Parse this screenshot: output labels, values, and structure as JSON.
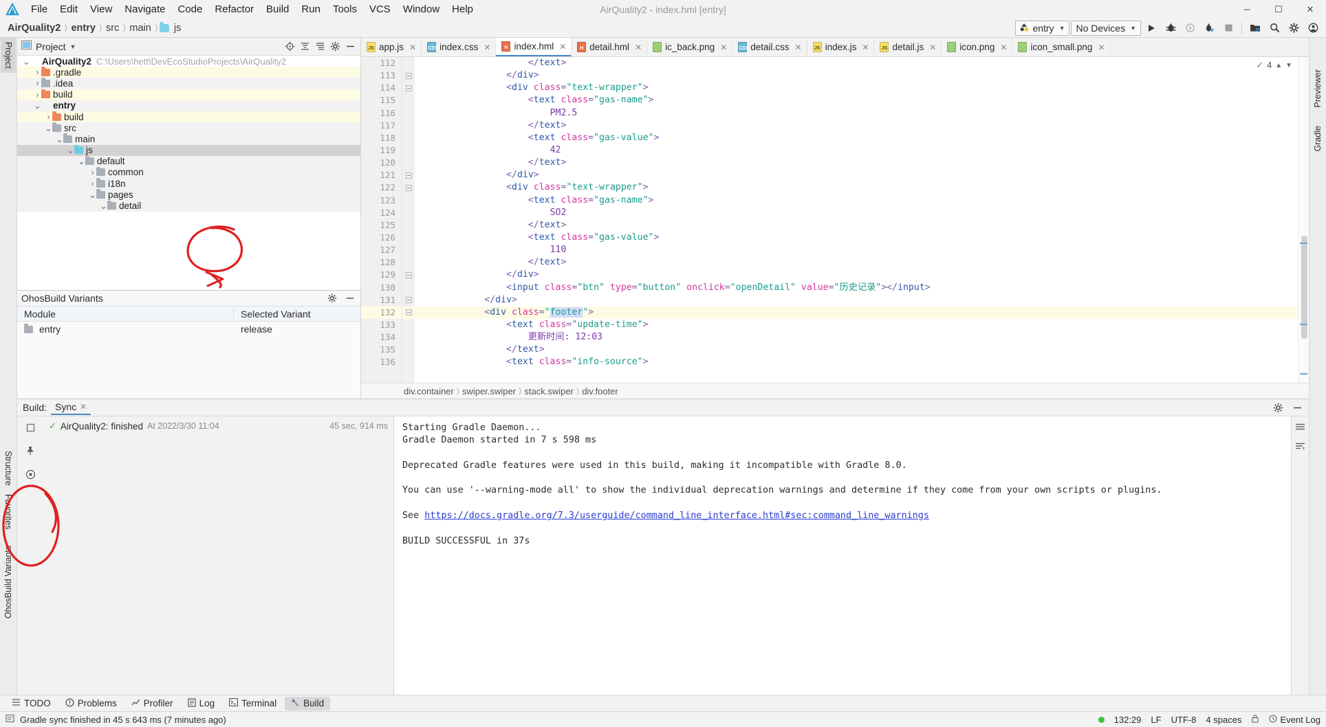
{
  "window": {
    "title": "AirQuality2 - index.hml [entry]",
    "minimize": "─",
    "maximize": "☐",
    "close": "✕"
  },
  "menu": {
    "items": [
      "File",
      "Edit",
      "View",
      "Navigate",
      "Code",
      "Refactor",
      "Build",
      "Run",
      "Tools",
      "VCS",
      "Window",
      "Help"
    ]
  },
  "navbar": {
    "breadcrumbs": [
      {
        "label": "AirQuality2",
        "bold": true,
        "folder": false
      },
      {
        "label": "entry",
        "bold": true,
        "folder": false
      },
      {
        "label": "src",
        "bold": false,
        "folder": false
      },
      {
        "label": "main",
        "bold": false,
        "folder": false
      },
      {
        "label": "js",
        "bold": false,
        "folder": true
      }
    ],
    "run_config": "entry",
    "device": "No Devices",
    "icons": [
      "run-icon",
      "debug-icon",
      "attach-debugger-icon",
      "profile-icon",
      "stop-icon",
      "device-manager-icon",
      "search-everywhere-icon",
      "settings-icon",
      "account-icon"
    ]
  },
  "left_strip": {
    "tabs": [
      "Project",
      "Structure",
      "Favorites",
      "OhosBuild Variants"
    ]
  },
  "right_strip": {
    "tabs": [
      "Previewer",
      "Gradle"
    ]
  },
  "project_panel": {
    "title": "Project",
    "tree": [
      {
        "indent": 0,
        "arrow": "down",
        "icon": "module",
        "label": "AirQuality2",
        "bold": true,
        "path": "C:\\Users\\hett\\DevEcoStudioProjects\\AirQuality2",
        "bg": "w"
      },
      {
        "indent": 1,
        "arrow": "right",
        "icon": "orange",
        "label": ".gradle",
        "bold": false,
        "path": "",
        "bg": "y"
      },
      {
        "indent": 1,
        "arrow": "right",
        "icon": "gray",
        "label": ".idea",
        "bold": false,
        "path": "",
        "bg": "g"
      },
      {
        "indent": 1,
        "arrow": "right",
        "icon": "orange",
        "label": "build",
        "bold": false,
        "path": "",
        "bg": "y"
      },
      {
        "indent": 1,
        "arrow": "down",
        "icon": "module",
        "label": "entry",
        "bold": true,
        "path": "",
        "bg": "g"
      },
      {
        "indent": 2,
        "arrow": "right",
        "icon": "orange",
        "label": "build",
        "bold": false,
        "path": "",
        "bg": "y"
      },
      {
        "indent": 2,
        "arrow": "down",
        "icon": "gray",
        "label": "src",
        "bold": false,
        "path": "",
        "bg": "g"
      },
      {
        "indent": 3,
        "arrow": "down",
        "icon": "gray",
        "label": "main",
        "bold": false,
        "path": "",
        "bg": "g"
      },
      {
        "indent": 4,
        "arrow": "down",
        "icon": "blue",
        "label": "js",
        "bold": false,
        "path": "",
        "bg": "sel"
      },
      {
        "indent": 5,
        "arrow": "down",
        "icon": "gray",
        "label": "default",
        "bold": false,
        "path": "",
        "bg": "g"
      },
      {
        "indent": 6,
        "arrow": "right",
        "icon": "gray",
        "label": "common",
        "bold": false,
        "path": "",
        "bg": "g"
      },
      {
        "indent": 6,
        "arrow": "right",
        "icon": "gray",
        "label": "i18n",
        "bold": false,
        "path": "",
        "bg": "g"
      },
      {
        "indent": 6,
        "arrow": "down",
        "icon": "gray",
        "label": "pages",
        "bold": false,
        "path": "",
        "bg": "g"
      },
      {
        "indent": 7,
        "arrow": "down",
        "icon": "gray",
        "label": "detail",
        "bold": false,
        "path": "",
        "bg": "g"
      }
    ]
  },
  "build_variants": {
    "title": "OhosBuild Variants",
    "columns": [
      "Module",
      "Selected Variant"
    ],
    "rows": [
      {
        "module": "entry",
        "variant": "release"
      }
    ]
  },
  "editor": {
    "tabs": [
      {
        "label": "app.js",
        "kind": "js",
        "badge": "JS",
        "active": false
      },
      {
        "label": "index.css",
        "kind": "css",
        "badge": "CSS",
        "active": false
      },
      {
        "label": "index.hml",
        "kind": "hml",
        "badge": "H",
        "active": true
      },
      {
        "label": "detail.hml",
        "kind": "hml",
        "badge": "H",
        "active": false
      },
      {
        "label": "ic_back.png",
        "kind": "png",
        "badge": "",
        "active": false
      },
      {
        "label": "detail.css",
        "kind": "css",
        "badge": "CSS",
        "active": false
      },
      {
        "label": "index.js",
        "kind": "js",
        "badge": "JS",
        "active": false
      },
      {
        "label": "detail.js",
        "kind": "js",
        "badge": "JS",
        "active": false
      },
      {
        "label": "icon.png",
        "kind": "png",
        "badge": "",
        "active": false
      },
      {
        "label": "icon_small.png",
        "kind": "png",
        "badge": "",
        "active": false
      }
    ],
    "inspection_count": "4",
    "first_line": 112,
    "current_line": 132,
    "lines": [
      {
        "n": 112,
        "indent": 10,
        "fold": false,
        "parts": [
          {
            "t": "ang",
            "s": "</"
          },
          {
            "t": "tag",
            "s": "text"
          },
          {
            "t": "ang",
            "s": ">"
          }
        ]
      },
      {
        "n": 113,
        "indent": 8,
        "fold": true,
        "parts": [
          {
            "t": "ang",
            "s": "</"
          },
          {
            "t": "tag",
            "s": "div"
          },
          {
            "t": "ang",
            "s": ">"
          }
        ]
      },
      {
        "n": 114,
        "indent": 8,
        "fold": true,
        "parts": [
          {
            "t": "ang",
            "s": "<"
          },
          {
            "t": "tag",
            "s": "div "
          },
          {
            "t": "attr",
            "s": "class"
          },
          {
            "t": "ang",
            "s": "="
          },
          {
            "t": "str",
            "s": "\"text-wrapper\""
          },
          {
            "t": "ang",
            "s": ">"
          }
        ]
      },
      {
        "n": 115,
        "indent": 10,
        "fold": false,
        "parts": [
          {
            "t": "ang",
            "s": "<"
          },
          {
            "t": "tag",
            "s": "text "
          },
          {
            "t": "attr",
            "s": "class"
          },
          {
            "t": "ang",
            "s": "="
          },
          {
            "t": "str",
            "s": "\"gas-name\""
          },
          {
            "t": "ang",
            "s": ">"
          }
        ]
      },
      {
        "n": 116,
        "indent": 12,
        "fold": false,
        "parts": [
          {
            "t": "txtc",
            "s": "PM2.5"
          }
        ]
      },
      {
        "n": 117,
        "indent": 10,
        "fold": false,
        "parts": [
          {
            "t": "ang",
            "s": "</"
          },
          {
            "t": "tag",
            "s": "text"
          },
          {
            "t": "ang",
            "s": ">"
          }
        ]
      },
      {
        "n": 118,
        "indent": 10,
        "fold": false,
        "parts": [
          {
            "t": "ang",
            "s": "<"
          },
          {
            "t": "tag",
            "s": "text "
          },
          {
            "t": "attr",
            "s": "class"
          },
          {
            "t": "ang",
            "s": "="
          },
          {
            "t": "str",
            "s": "\"gas-value\""
          },
          {
            "t": "ang",
            "s": ">"
          }
        ]
      },
      {
        "n": 119,
        "indent": 12,
        "fold": false,
        "parts": [
          {
            "t": "txtc",
            "s": "42"
          }
        ]
      },
      {
        "n": 120,
        "indent": 10,
        "fold": false,
        "parts": [
          {
            "t": "ang",
            "s": "</"
          },
          {
            "t": "tag",
            "s": "text"
          },
          {
            "t": "ang",
            "s": ">"
          }
        ]
      },
      {
        "n": 121,
        "indent": 8,
        "fold": true,
        "parts": [
          {
            "t": "ang",
            "s": "</"
          },
          {
            "t": "tag",
            "s": "div"
          },
          {
            "t": "ang",
            "s": ">"
          }
        ]
      },
      {
        "n": 122,
        "indent": 8,
        "fold": true,
        "parts": [
          {
            "t": "ang",
            "s": "<"
          },
          {
            "t": "tag",
            "s": "div "
          },
          {
            "t": "attr",
            "s": "class"
          },
          {
            "t": "ang",
            "s": "="
          },
          {
            "t": "str",
            "s": "\"text-wrapper\""
          },
          {
            "t": "ang",
            "s": ">"
          }
        ]
      },
      {
        "n": 123,
        "indent": 10,
        "fold": false,
        "parts": [
          {
            "t": "ang",
            "s": "<"
          },
          {
            "t": "tag",
            "s": "text "
          },
          {
            "t": "attr",
            "s": "class"
          },
          {
            "t": "ang",
            "s": "="
          },
          {
            "t": "str",
            "s": "\"gas-name\""
          },
          {
            "t": "ang",
            "s": ">"
          }
        ]
      },
      {
        "n": 124,
        "indent": 12,
        "fold": false,
        "parts": [
          {
            "t": "txtc",
            "s": "SO2"
          }
        ]
      },
      {
        "n": 125,
        "indent": 10,
        "fold": false,
        "parts": [
          {
            "t": "ang",
            "s": "</"
          },
          {
            "t": "tag",
            "s": "text"
          },
          {
            "t": "ang",
            "s": ">"
          }
        ]
      },
      {
        "n": 126,
        "indent": 10,
        "fold": false,
        "parts": [
          {
            "t": "ang",
            "s": "<"
          },
          {
            "t": "tag",
            "s": "text "
          },
          {
            "t": "attr",
            "s": "class"
          },
          {
            "t": "ang",
            "s": "="
          },
          {
            "t": "str",
            "s": "\"gas-value\""
          },
          {
            "t": "ang",
            "s": ">"
          }
        ]
      },
      {
        "n": 127,
        "indent": 12,
        "fold": false,
        "parts": [
          {
            "t": "txtc",
            "s": "110"
          }
        ]
      },
      {
        "n": 128,
        "indent": 10,
        "fold": false,
        "parts": [
          {
            "t": "ang",
            "s": "</"
          },
          {
            "t": "tag",
            "s": "text"
          },
          {
            "t": "ang",
            "s": ">"
          }
        ]
      },
      {
        "n": 129,
        "indent": 8,
        "fold": true,
        "parts": [
          {
            "t": "ang",
            "s": "</"
          },
          {
            "t": "tag",
            "s": "div"
          },
          {
            "t": "ang",
            "s": ">"
          }
        ]
      },
      {
        "n": 130,
        "indent": 8,
        "fold": false,
        "parts": [
          {
            "t": "ang",
            "s": "<"
          },
          {
            "t": "tag",
            "s": "input "
          },
          {
            "t": "attr",
            "s": "class"
          },
          {
            "t": "ang",
            "s": "="
          },
          {
            "t": "str",
            "s": "\"btn\""
          },
          {
            "t": "ang",
            "s": " "
          },
          {
            "t": "attr",
            "s": "type"
          },
          {
            "t": "ang",
            "s": "="
          },
          {
            "t": "str",
            "s": "\"button\""
          },
          {
            "t": "ang",
            "s": " "
          },
          {
            "t": "attr",
            "s": "onclick"
          },
          {
            "t": "ang",
            "s": "="
          },
          {
            "t": "str",
            "s": "\"openDetail\""
          },
          {
            "t": "ang",
            "s": " "
          },
          {
            "t": "attr",
            "s": "value"
          },
          {
            "t": "ang",
            "s": "="
          },
          {
            "t": "str",
            "s": "\"历史记录\""
          },
          {
            "t": "ang",
            "s": ">"
          },
          {
            "t": "ang",
            "s": "</"
          },
          {
            "t": "tag",
            "s": "input"
          },
          {
            "t": "ang",
            "s": ">"
          }
        ]
      },
      {
        "n": 131,
        "indent": 6,
        "fold": true,
        "parts": [
          {
            "t": "ang",
            "s": "</"
          },
          {
            "t": "tag",
            "s": "div"
          },
          {
            "t": "ang",
            "s": ">"
          }
        ]
      },
      {
        "n": 132,
        "indent": 6,
        "fold": true,
        "parts": [
          {
            "t": "ang",
            "s": "<"
          },
          {
            "t": "tag",
            "s": "div "
          },
          {
            "t": "attr",
            "s": "class"
          },
          {
            "t": "ang",
            "s": "="
          },
          {
            "t": "str",
            "s": "\""
          },
          {
            "t": "sel",
            "s": "footer"
          },
          {
            "t": "str",
            "s": "\""
          },
          {
            "t": "ang",
            "s": ">"
          }
        ]
      },
      {
        "n": 133,
        "indent": 8,
        "fold": false,
        "parts": [
          {
            "t": "ang",
            "s": "<"
          },
          {
            "t": "tag",
            "s": "text "
          },
          {
            "t": "attr",
            "s": "class"
          },
          {
            "t": "ang",
            "s": "="
          },
          {
            "t": "str",
            "s": "\"update-time\""
          },
          {
            "t": "ang",
            "s": ">"
          }
        ]
      },
      {
        "n": 134,
        "indent": 10,
        "fold": false,
        "parts": [
          {
            "t": "txtc",
            "s": "更新时间: 12:03"
          }
        ]
      },
      {
        "n": 135,
        "indent": 8,
        "fold": false,
        "parts": [
          {
            "t": "ang",
            "s": "</"
          },
          {
            "t": "tag",
            "s": "text"
          },
          {
            "t": "ang",
            "s": ">"
          }
        ]
      },
      {
        "n": 136,
        "indent": 8,
        "fold": false,
        "parts": [
          {
            "t": "ang",
            "s": "<"
          },
          {
            "t": "tag",
            "s": "text "
          },
          {
            "t": "attr",
            "s": "class"
          },
          {
            "t": "ang",
            "s": "="
          },
          {
            "t": "str",
            "s": "\"info-source\""
          },
          {
            "t": "ang",
            "s": ">"
          }
        ]
      }
    ],
    "structure_crumbs": [
      "div.container",
      "swiper.swiper",
      "stack.swiper",
      "div.footer"
    ]
  },
  "build_window": {
    "label": "Build:",
    "tab": "Sync",
    "tree_row": {
      "status": "AirQuality2: finished",
      "timestamp": "At 2022/3/30 11:04",
      "duration": "45 sec, 914 ms"
    },
    "log": [
      {
        "text": "Starting Gradle Daemon...",
        "link": null
      },
      {
        "text": "Gradle Daemon started in 7 s 598 ms",
        "link": null
      },
      {
        "text": "",
        "link": null
      },
      {
        "text": "Deprecated Gradle features were used in this build, making it incompatible with Gradle 8.0.",
        "link": null
      },
      {
        "text": "",
        "link": null
      },
      {
        "text": "You can use '--warning-mode all' to show the individual deprecation warnings and determine if they come from your own scripts or plugins.",
        "link": null
      },
      {
        "text": "",
        "link": null
      },
      {
        "text": "See ",
        "link": "https://docs.gradle.org/7.3/userguide/command_line_interface.html#sec:command_line_warnings"
      },
      {
        "text": "",
        "link": null
      },
      {
        "text": "BUILD SUCCESSFUL in 37s",
        "link": null
      }
    ]
  },
  "bottom_bar": {
    "items": [
      {
        "label": "TODO",
        "icon": "todo-icon",
        "active": false
      },
      {
        "label": "Problems",
        "icon": "problems-icon",
        "active": false
      },
      {
        "label": "Profiler",
        "icon": "profiler-icon",
        "active": false
      },
      {
        "label": "Log",
        "icon": "log-icon",
        "active": false
      },
      {
        "label": "Terminal",
        "icon": "terminal-icon",
        "active": false
      },
      {
        "label": "Build",
        "icon": "build-icon",
        "active": true
      }
    ]
  },
  "status_bar": {
    "message": "Gradle sync finished in 45 s 643 ms (7 minutes ago)",
    "caret": "132:29",
    "line_sep": "LF",
    "encoding": "UTF-8",
    "indent": "4 spaces",
    "event_log": "Event Log"
  },
  "colors": {
    "accent": "#4a88c7",
    "annotation": "#e02020",
    "success": "#3ec33e",
    "folder_orange": "#f0875a",
    "folder_blue": "#6fcbe3"
  }
}
